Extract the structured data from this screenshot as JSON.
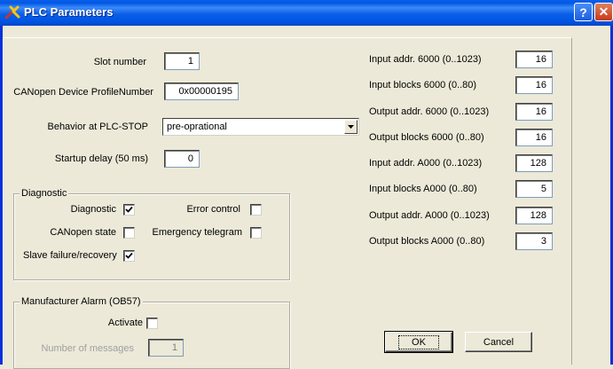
{
  "window": {
    "title": "PLC Parameters",
    "help_label": "?",
    "close_label": "✕"
  },
  "colors": {
    "titlebar": "#0054e3",
    "window_bg": "#ece9d8",
    "field_bg": "#ffffff"
  },
  "general": {
    "slot_number_label": "Slot number",
    "slot_number_value": "1",
    "profile_label": "CANopen Device ProfileNumber",
    "profile_value": "0x00000195",
    "behavior_label": "Behavior at PLC-STOP",
    "behavior_value": "pre-oprational",
    "startup_label": "Startup delay (50 ms)",
    "startup_value": "0"
  },
  "diagnostic": {
    "group_title": "Diagnostic",
    "diagnostic_label": "Diagnostic",
    "diagnostic_checked": true,
    "error_control_label": "Error control",
    "error_control_checked": false,
    "canopen_state_label": "CANopen state",
    "canopen_state_checked": false,
    "emergency_label": "Emergency telegram",
    "emergency_checked": false,
    "slave_failure_label": "Slave failure/recovery",
    "slave_failure_checked": true
  },
  "alarm": {
    "group_title": "Manufacturer Alarm (OB57)",
    "activate_label": "Activate",
    "activate_checked": false,
    "messages_label": "Number of messages",
    "messages_value": "1"
  },
  "io": [
    {
      "label": "Input addr.  6000  (0..1023)",
      "value": "16"
    },
    {
      "label": "Input blocks  6000  (0..80)",
      "value": "16"
    },
    {
      "label": "Output addr.  6000  (0..1023)",
      "value": "16"
    },
    {
      "label": "Output blocks 6000  (0..80)",
      "value": "16"
    },
    {
      "label": "Input addr.  A000  (0..1023)",
      "value": "128"
    },
    {
      "label": "Input blocks  A000  (0..80)",
      "value": "5"
    },
    {
      "label": "Output addr.  A000  (0..1023)",
      "value": "128"
    },
    {
      "label": "Output blocks A000  (0..80)",
      "value": "3"
    }
  ],
  "buttons": {
    "ok_label": "OK",
    "cancel_label": "Cancel"
  }
}
